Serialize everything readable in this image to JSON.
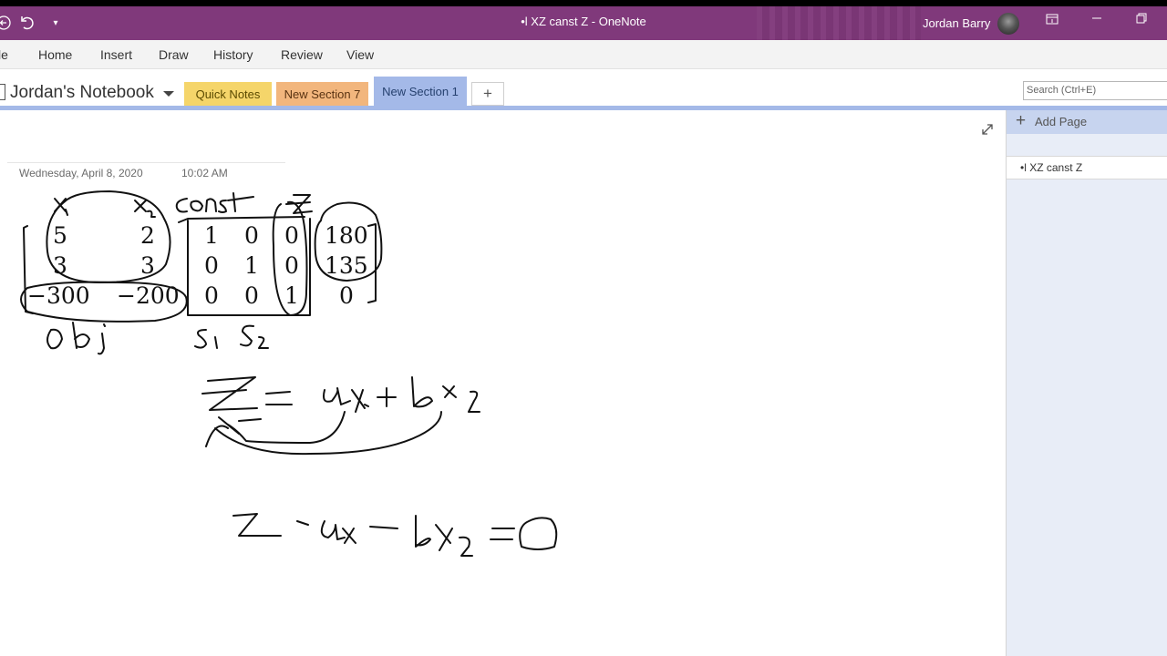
{
  "window": {
    "title": "•l XZ canst Z  -  OneNote",
    "user_name": "Jordan Barry"
  },
  "ribbon": {
    "tabs": [
      "le",
      "Home",
      "Insert",
      "Draw",
      "History",
      "Review",
      "View"
    ]
  },
  "notebook": {
    "name": "Jordan's Notebook",
    "sections": [
      {
        "label": "Quick Notes",
        "color": "#f5d56a"
      },
      {
        "label": "New Section 7",
        "color": "#f2b67d"
      },
      {
        "label": "New Section 1",
        "color": "#a4b9e8",
        "active": true
      }
    ],
    "add_section": "+"
  },
  "search": {
    "placeholder": "Search (Ctrl+E)"
  },
  "page": {
    "date": "Wednesday, April 8, 2020",
    "time": "10:02 AM"
  },
  "ink_text": {
    "row1": [
      "5",
      "2",
      "1",
      "0",
      "0",
      "180"
    ],
    "row2": [
      "3",
      "3",
      "0",
      "1",
      "0",
      "135"
    ],
    "row3": [
      "−300",
      "−200",
      "0",
      "0",
      "1",
      "0"
    ]
  },
  "pages_pane": {
    "add_page_label": "Add Page",
    "pages": [
      "•l XZ canst Z"
    ]
  },
  "icons": {
    "window_controls": [
      "minimize-icon",
      "restore-icon",
      "close-icon"
    ],
    "quick_access": [
      "back-icon",
      "undo-icon",
      "customize-icon"
    ]
  }
}
